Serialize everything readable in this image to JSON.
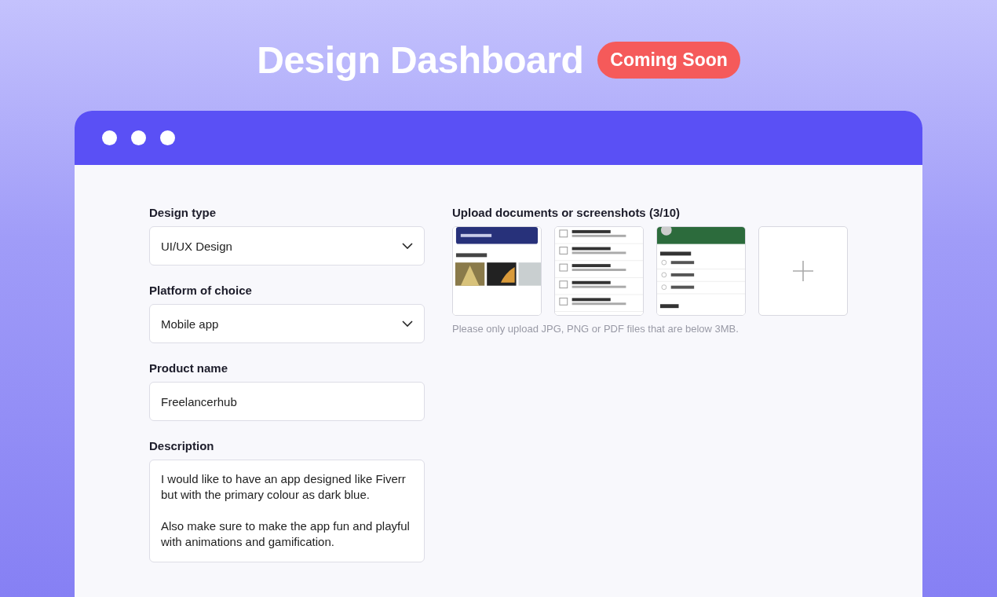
{
  "header": {
    "title": "Design Dashboard",
    "badge": "Coming Soon"
  },
  "form": {
    "fields": [
      {
        "kind": "select",
        "label": "Design type",
        "value": "UI/UX Design"
      },
      {
        "kind": "select",
        "label": "Platform of choice",
        "value": "Mobile app"
      },
      {
        "kind": "text",
        "label": "Product name",
        "value": "Freelancerhub"
      },
      {
        "kind": "textarea",
        "label": "Description",
        "value": "I would like to have an app designed like Fiverr but with the primary colour as dark blue.\n\nAlso make sure to make the app fun and playful with animations and gamification."
      }
    ]
  },
  "upload": {
    "title": "Upload documents or screenshots (3/10)",
    "hint": "Please only upload JPG, PNG or PDF files that are below 3MB.",
    "thumbnails": [
      {
        "kind": "picture"
      },
      {
        "kind": "picture"
      },
      {
        "kind": "picture"
      },
      {
        "kind": "add"
      }
    ]
  }
}
